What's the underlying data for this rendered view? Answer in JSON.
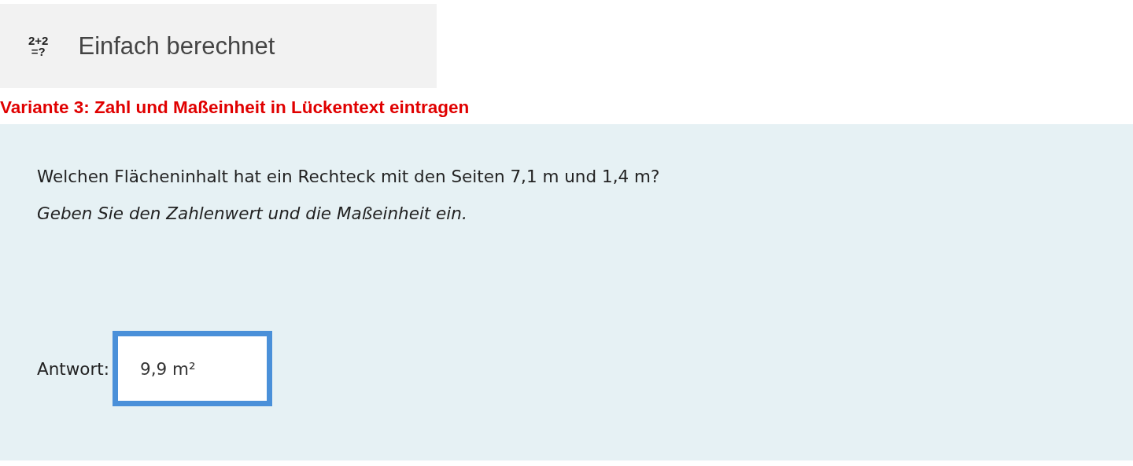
{
  "header": {
    "icon_lines": [
      "2+2",
      "=?"
    ],
    "title": "Einfach berechnet"
  },
  "variant_heading": "Variante 3: Zahl und Maßeinheit in Lückentext eintragen",
  "question": {
    "text": "Welchen Flächeninhalt hat ein Rechteck mit den Seiten 7,1 m und 1,4 m?",
    "instruction": "Geben Sie den Zahlenwert und die Maßeinheit ein.",
    "answer_label": "Antwort:",
    "answer_value": "9,9 m²",
    "answer_focused": true
  }
}
